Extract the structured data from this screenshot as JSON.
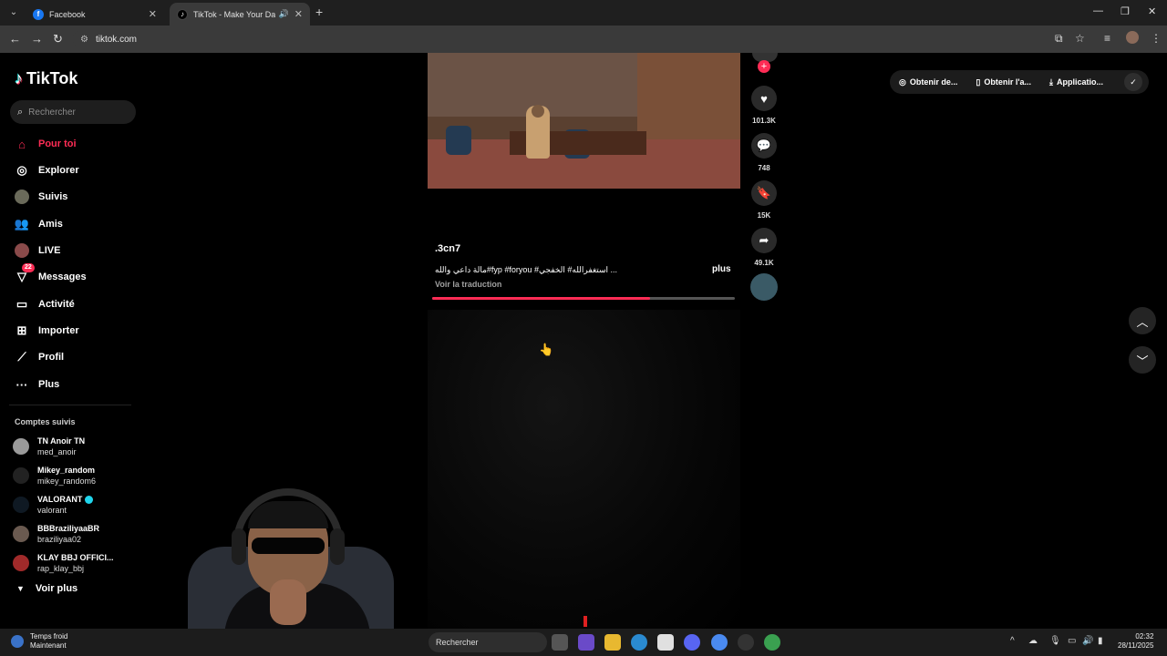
{
  "browser": {
    "tabs": [
      {
        "title": "Facebook",
        "favicon": "f"
      },
      {
        "title": "TikTok - Make Your Day",
        "favicon": "♪"
      }
    ],
    "address": "tiktok.com"
  },
  "sidebar": {
    "logo": "TikTok",
    "search_placeholder": "Rechercher",
    "nav": [
      {
        "label": "Pour toi",
        "icon": "home-icon"
      },
      {
        "label": "Explorer",
        "icon": "compass-icon"
      },
      {
        "label": "Suivis",
        "icon": "following-avatar-icon"
      },
      {
        "label": "Amis",
        "icon": "friends-icon"
      },
      {
        "label": "LIVE",
        "icon": "live-icon"
      },
      {
        "label": "Messages",
        "icon": "messages-icon",
        "badge": "22"
      },
      {
        "label": "Activité",
        "icon": "activity-icon"
      },
      {
        "label": "Importer",
        "icon": "upload-icon"
      },
      {
        "label": "Profil",
        "icon": "profile-icon"
      },
      {
        "label": "Plus",
        "icon": "more-icon"
      }
    ],
    "following_title": "Comptes suivis",
    "following": [
      {
        "name": "TN Anoir TN",
        "username": "med_anoir"
      },
      {
        "name": "Mikey_random",
        "username": "mikey_random6"
      },
      {
        "name": "VALORANT",
        "username": "valorant",
        "verified": true
      },
      {
        "name": "BBBraziliyaaBR",
        "username": "braziliyaa02"
      },
      {
        "name": "KLAY BBJ OFFICI...",
        "username": "rap_klay_bbj"
      }
    ],
    "see_more": "Voir plus"
  },
  "video": {
    "author": ".3cn7",
    "description": "مالة داعي والله#fyp #foryou #استغفرالله# الخفجي ...",
    "more": "plus",
    "translate": "Voir la traduction",
    "progress": 0.72
  },
  "actions": {
    "likes": "101.3K",
    "comments": "748",
    "saves": "15K",
    "shares": "49.1K"
  },
  "top_actions": [
    {
      "label": "Obtenir de...",
      "icon": "coin-icon"
    },
    {
      "label": "Obtenir l'a...",
      "icon": "phone-icon"
    },
    {
      "label": "Applicatio...",
      "icon": "download-icon"
    }
  ],
  "taskbar": {
    "weather_title": "Temps froid",
    "weather_sub": "Maintenant",
    "search": "Rechercher",
    "time": "02:32",
    "date": "28/11/2025"
  },
  "colors": {
    "accent": "#fe2c55",
    "background": "#000000"
  }
}
